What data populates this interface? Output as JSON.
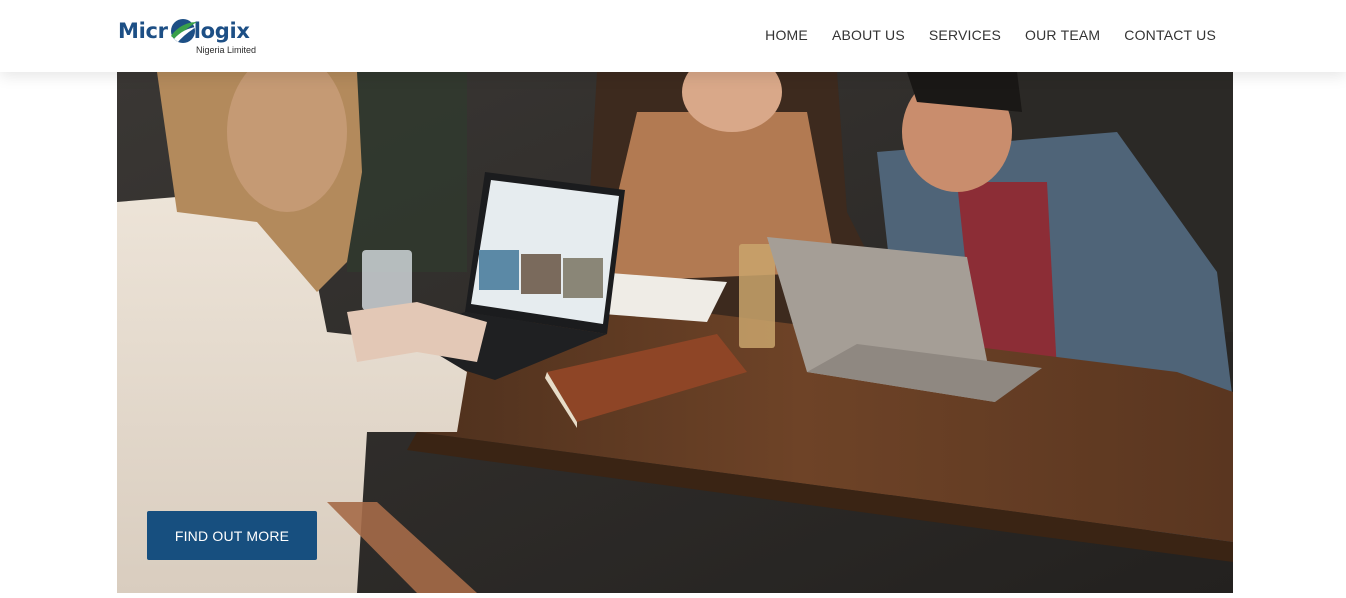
{
  "header": {
    "logo": {
      "name_part1": "Micr",
      "name_part2": "logix",
      "subtitle": "Nigeria Limited",
      "brand_color": "#1d4f85",
      "accent_color": "#3aa04a"
    },
    "nav": [
      {
        "label": "HOME"
      },
      {
        "label": "ABOUT US"
      },
      {
        "label": "SERVICES"
      },
      {
        "label": "OUR TEAM"
      },
      {
        "label": "CONTACT US"
      }
    ]
  },
  "hero": {
    "image": "photo-three-women-laughing-at-table-with-laptops",
    "cta_label": "FIND OUT MORE",
    "cta_color": "#174f7f"
  }
}
